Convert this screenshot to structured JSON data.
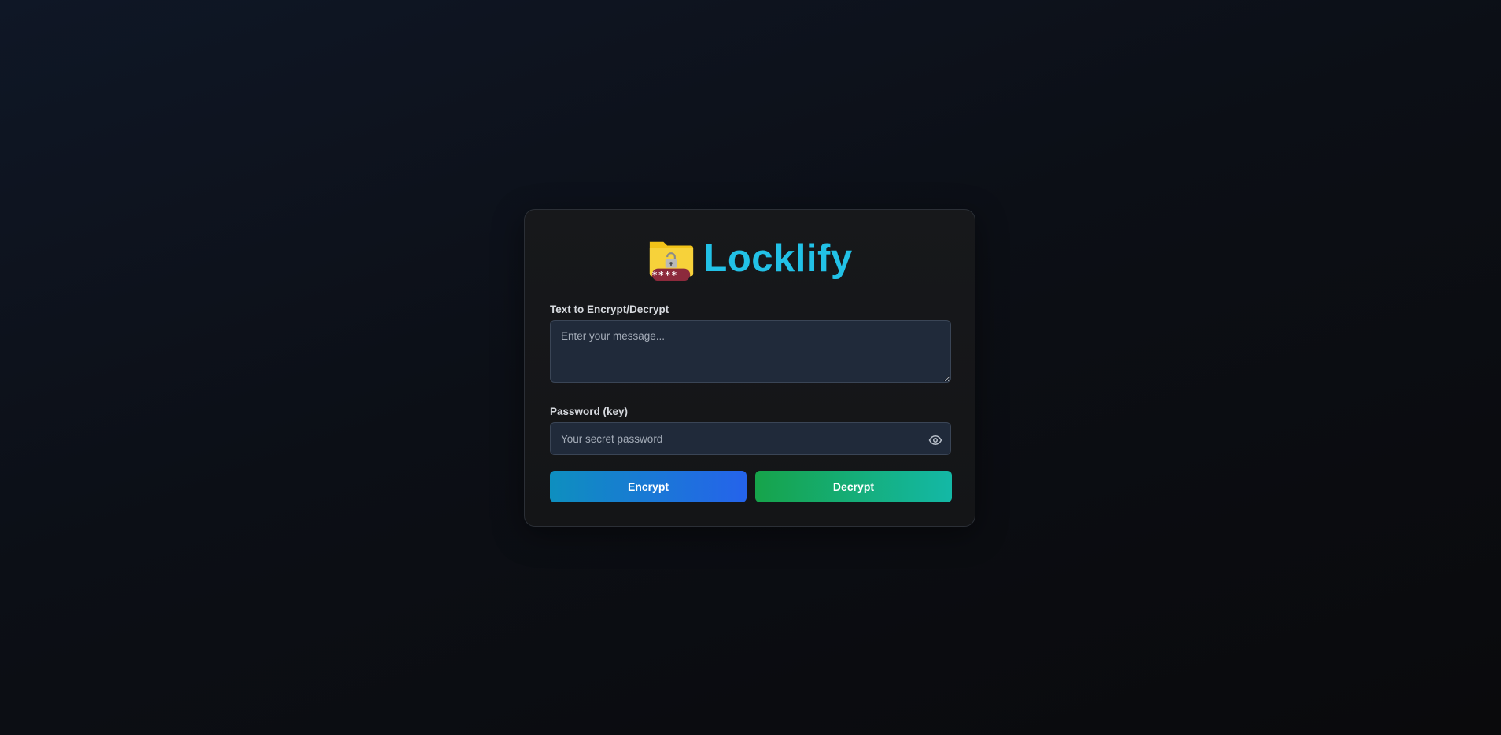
{
  "app": {
    "title": "Locklify",
    "logo_icon": "locked-folder-icon",
    "logo_badge_text": "****",
    "accent_color": "#22c1e6"
  },
  "form": {
    "message": {
      "label": "Text to Encrypt/Decrypt",
      "placeholder": "Enter your message...",
      "value": ""
    },
    "password": {
      "label": "Password (key)",
      "placeholder": "Your secret password",
      "value": "",
      "toggle_icon": "eye-icon"
    }
  },
  "actions": {
    "encrypt_label": "Encrypt",
    "decrypt_label": "Decrypt",
    "encrypt_colors": [
      "#0e8fbf",
      "#2563eb"
    ],
    "decrypt_colors": [
      "#16a34a",
      "#14b8a6"
    ]
  }
}
